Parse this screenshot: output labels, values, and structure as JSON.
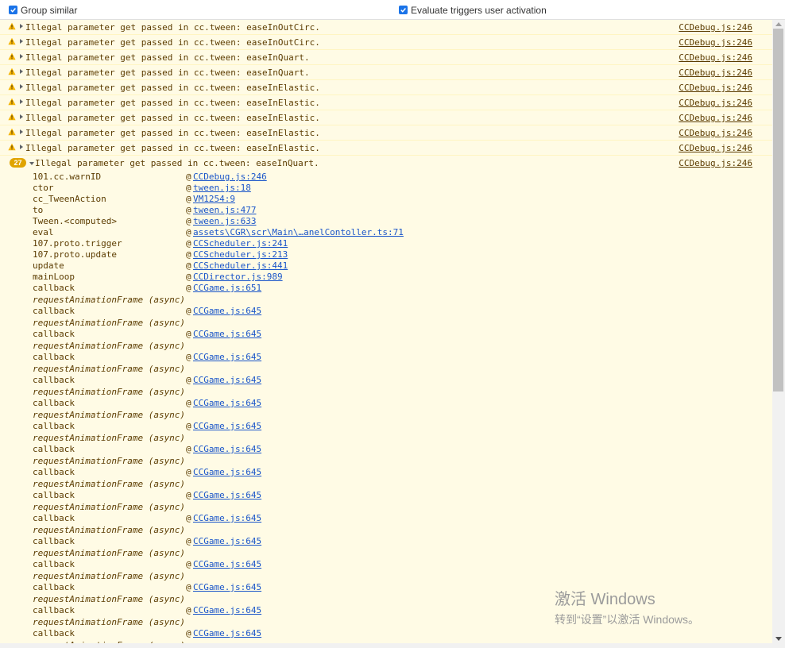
{
  "toolbar": {
    "group_similar_label": "Group similar",
    "evaluate_triggers_label": "Evaluate triggers user activation"
  },
  "warnings": [
    {
      "message": "Illegal parameter get passed in cc.tween: easeInOutCirc.",
      "source": "CCDebug.js:246"
    },
    {
      "message": "Illegal parameter get passed in cc.tween: easeInOutCirc.",
      "source": "CCDebug.js:246"
    },
    {
      "message": "Illegal parameter get passed in cc.tween: easeInQuart.",
      "source": "CCDebug.js:246"
    },
    {
      "message": "Illegal parameter get passed in cc.tween: easeInQuart.",
      "source": "CCDebug.js:246"
    },
    {
      "message": "Illegal parameter get passed in cc.tween: easeInElastic.",
      "source": "CCDebug.js:246"
    },
    {
      "message": "Illegal parameter get passed in cc.tween: easeInElastic.",
      "source": "CCDebug.js:246"
    },
    {
      "message": "Illegal parameter get passed in cc.tween: easeInElastic.",
      "source": "CCDebug.js:246"
    },
    {
      "message": "Illegal parameter get passed in cc.tween: easeInElastic.",
      "source": "CCDebug.js:246"
    },
    {
      "message": "Illegal parameter get passed in cc.tween: easeInElastic.",
      "source": "CCDebug.js:246"
    }
  ],
  "group": {
    "count": "27",
    "message": "Illegal parameter get passed in cc.tween: easeInQuart.",
    "source": "CCDebug.js:246"
  },
  "stack_head": [
    {
      "fn": "101.cc.warnID",
      "loc": "CCDebug.js:246"
    },
    {
      "fn": "ctor",
      "loc": "tween.js:18"
    },
    {
      "fn": "cc_TweenAction",
      "loc": "VM1254:9"
    },
    {
      "fn": "to",
      "loc": "tween.js:477"
    },
    {
      "fn": "Tween.<computed>",
      "loc": "tween.js:633"
    },
    {
      "fn": "eval",
      "loc": "assets\\CGR\\scr\\Main\\…anelContoller.ts:71"
    },
    {
      "fn": "107.proto.trigger",
      "loc": "CCScheduler.js:241"
    },
    {
      "fn": "107.proto.update",
      "loc": "CCScheduler.js:213"
    },
    {
      "fn": "update",
      "loc": "CCScheduler.js:441"
    },
    {
      "fn": "mainLoop",
      "loc": "CCDirector.js:989"
    },
    {
      "fn": "callback",
      "loc": "CCGame.js:651"
    }
  ],
  "at_symbol": "@",
  "async_label": "requestAnimationFrame (async)",
  "callback_frame": {
    "fn": "callback",
    "loc": "CCGame.js:645"
  },
  "callback_repeats": 15,
  "watermark": {
    "line1": "激活 Windows",
    "line2": "转到“设置”以激活 Windows。"
  },
  "colors": {
    "warning_bg": "#fffbe5",
    "warning_text": "#5c3c00",
    "link_blue": "#1a55c9",
    "badge": "#e0a400",
    "checkbox": "#1a73e8"
  }
}
